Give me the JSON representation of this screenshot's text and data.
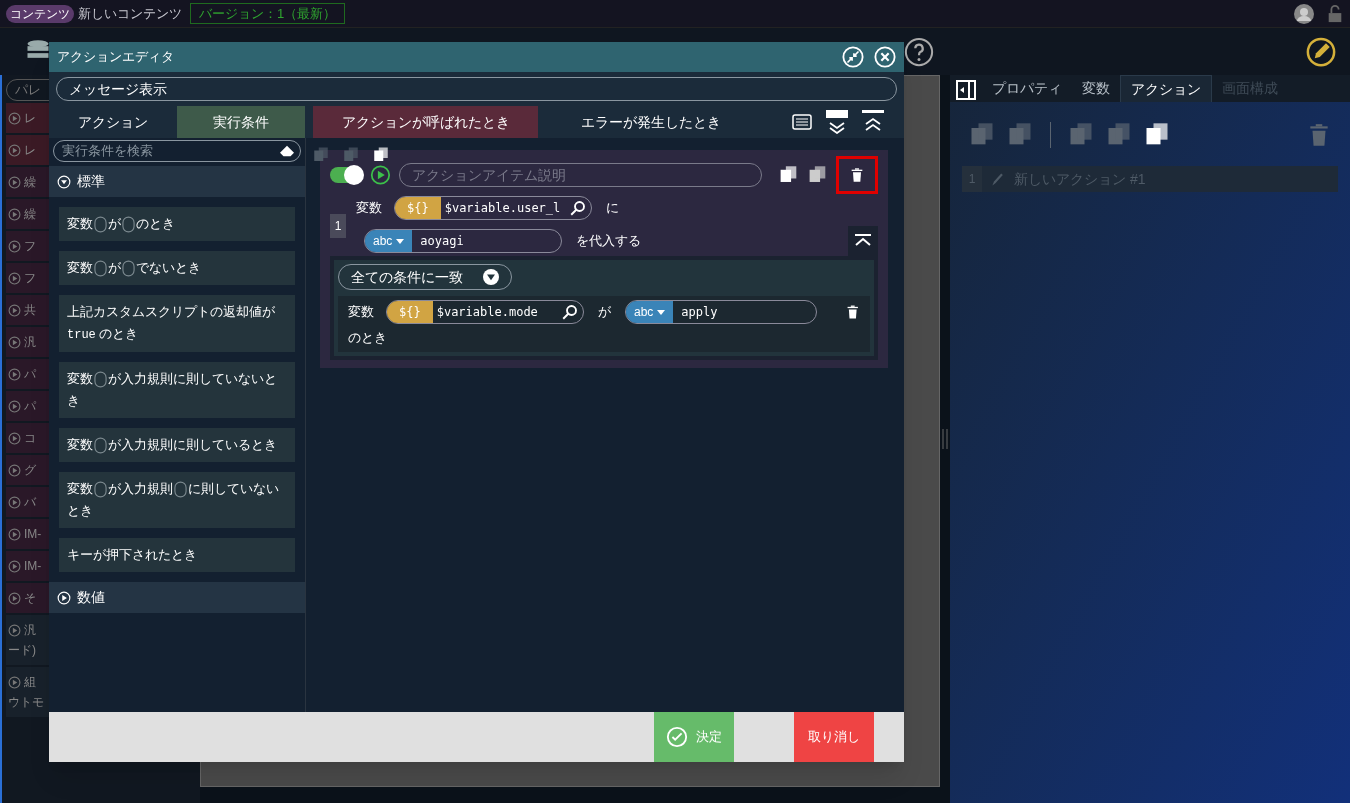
{
  "topbar": {
    "badge": "コンテンツ",
    "title": "新しいコンテンツ",
    "version": "バージョン：1（最新）"
  },
  "palette": {
    "search_placeholder": "パレ",
    "items": [
      {
        "kind": "accent",
        "lines": [
          "レ"
        ]
      },
      {
        "kind": "accent",
        "lines": [
          "レ"
        ]
      },
      {
        "kind": "group",
        "lines": [
          "繰"
        ]
      },
      {
        "kind": "group",
        "lines": [
          "繰"
        ]
      },
      {
        "kind": "group",
        "lines": [
          "フ"
        ]
      },
      {
        "kind": "group",
        "lines": [
          "フ"
        ]
      },
      {
        "kind": "group",
        "lines": [
          "共"
        ]
      },
      {
        "kind": "group",
        "lines": [
          "汎"
        ]
      },
      {
        "kind": "group",
        "lines": [
          "パ"
        ]
      },
      {
        "kind": "group",
        "lines": [
          "パ"
        ]
      },
      {
        "kind": "group",
        "lines": [
          "コ"
        ]
      },
      {
        "kind": "group",
        "lines": [
          "グ"
        ]
      },
      {
        "kind": "group",
        "lines": [
          "バ"
        ]
      },
      {
        "kind": "group",
        "lines": [
          "IM-"
        ]
      },
      {
        "kind": "group",
        "lines": [
          "IM-"
        ]
      },
      {
        "kind": "group",
        "lines": [
          "そ"
        ]
      },
      {
        "kind": "plain",
        "lines": [
          "汎",
          "ード)"
        ]
      },
      {
        "kind": "plain",
        "lines": [
          "組",
          "ウトモ"
        ]
      }
    ]
  },
  "right_panel": {
    "tabs": [
      {
        "label": "プロパティ",
        "selected": false,
        "disabled": false
      },
      {
        "label": "変数",
        "selected": false,
        "disabled": false
      },
      {
        "label": "アクション",
        "selected": true,
        "disabled": false
      },
      {
        "label": "画面構成",
        "selected": false,
        "disabled": true
      }
    ],
    "actions": [
      {
        "number": "1",
        "name": "新しいアクション #1"
      }
    ]
  },
  "editor": {
    "title": "アクションエディタ",
    "name": "メッセージ表示",
    "tabs": [
      {
        "label": "アクション",
        "selected": false
      },
      {
        "label": "実行条件",
        "selected": true
      }
    ],
    "event_tabs": [
      {
        "label": "アクションが呼ばれたとき",
        "selected": true
      },
      {
        "label": "エラーが発生したとき",
        "selected": false
      }
    ],
    "search_placeholder": "実行条件を検索",
    "categories": [
      {
        "label": "標準",
        "expanded": true,
        "items": [
          [
            {
              "kind": "text",
              "text": "変数"
            },
            {
              "kind": "slot"
            },
            {
              "kind": "text",
              "text": "が"
            },
            {
              "kind": "slot"
            },
            {
              "kind": "text",
              "text": "のとき"
            }
          ],
          [
            {
              "kind": "text",
              "text": "変数"
            },
            {
              "kind": "slot"
            },
            {
              "kind": "text",
              "text": "が"
            },
            {
              "kind": "slot"
            },
            {
              "kind": "text",
              "text": "でないとき"
            }
          ],
          [
            {
              "kind": "text",
              "text": "上記カスタムスクリプトの返却値が"
            },
            {
              "kind": "code",
              "text": "true"
            },
            {
              "kind": "text",
              "text": " のとき"
            }
          ],
          [
            {
              "kind": "text",
              "text": "変数"
            },
            {
              "kind": "slot"
            },
            {
              "kind": "text",
              "text": "が入力規則に則していないとき"
            }
          ],
          [
            {
              "kind": "text",
              "text": "変数"
            },
            {
              "kind": "slot"
            },
            {
              "kind": "text",
              "text": "が入力規則に則しているとき"
            }
          ],
          [
            {
              "kind": "text",
              "text": "変数"
            },
            {
              "kind": "slot"
            },
            {
              "kind": "text",
              "text": "が入力規則"
            },
            {
              "kind": "slot"
            },
            {
              "kind": "text",
              "text": "に則していないとき"
            }
          ],
          [
            {
              "kind": "text",
              "text": "キーが押下されたとき"
            }
          ]
        ]
      },
      {
        "label": "数値",
        "expanded": false
      }
    ],
    "action_item": {
      "enabled": true,
      "description_placeholder": "アクションアイテム説明",
      "number": "1",
      "statement": {
        "label": "変数",
        "var_badge": "${}",
        "variable": "$variable.user_l",
        "particle": "に",
        "type": "abc",
        "value": "aoyagi",
        "suffix": "を代入する"
      },
      "condition": {
        "match": "全ての条件に一致",
        "rows": [
          {
            "label": "変数",
            "var_badge": "${}",
            "variable": "$variable.mode",
            "particle": "が",
            "type": "abc",
            "value": "apply",
            "suffix": "のとき"
          }
        ]
      }
    },
    "buttons": {
      "ok": "決定",
      "cancel": "取り消し"
    }
  }
}
